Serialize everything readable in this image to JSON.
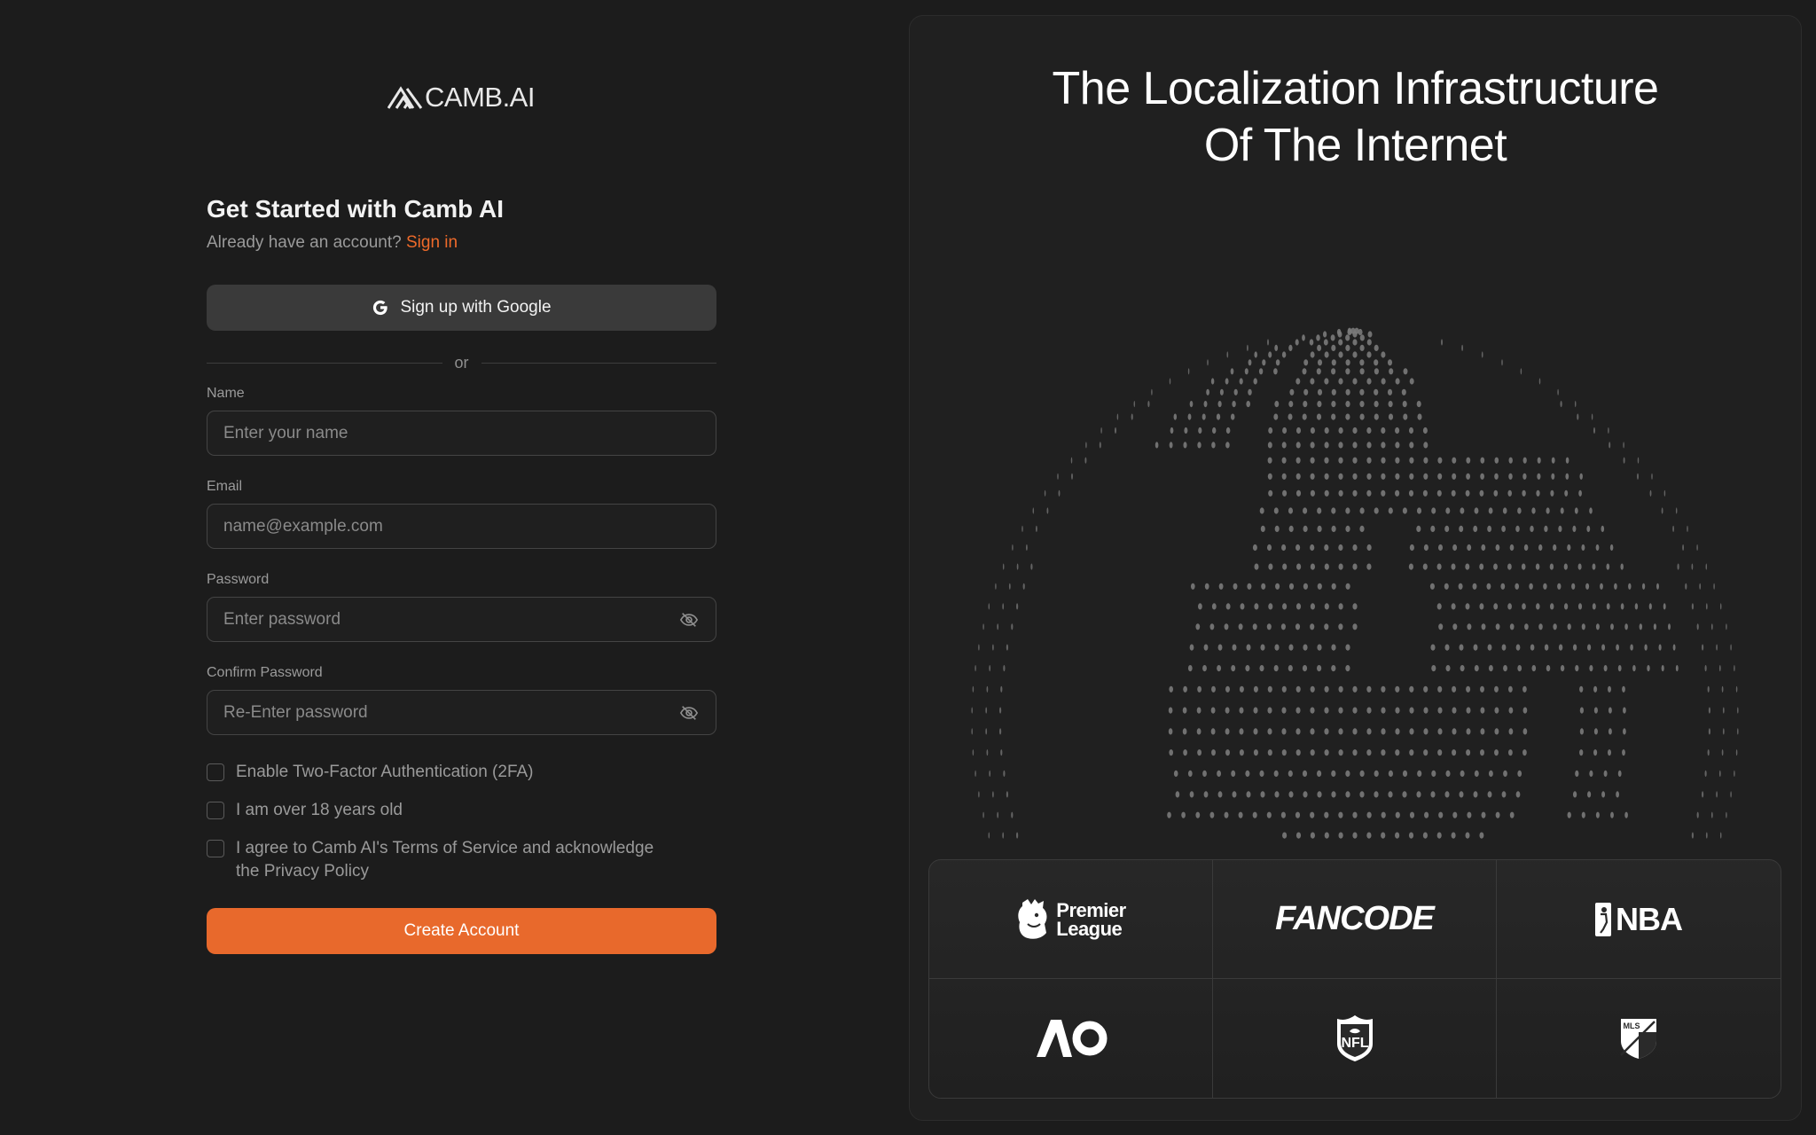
{
  "brand": {
    "logo_text": "CAMB.AI"
  },
  "signup": {
    "title": "Get Started with Camb AI",
    "have_account": "Already have an account?",
    "signin_link": "Sign in",
    "google_button": "Sign up with Google",
    "divider": "or",
    "fields": {
      "name": {
        "label": "Name",
        "placeholder": "Enter your name"
      },
      "email": {
        "label": "Email",
        "placeholder": "name@example.com"
      },
      "password": {
        "label": "Password",
        "placeholder": "Enter password"
      },
      "confirm": {
        "label": "Confirm Password",
        "placeholder": "Re-Enter password"
      }
    },
    "checks": {
      "twofa": "Enable Two-Factor Authentication (2FA)",
      "age": "I am over 18 years old",
      "terms": "I agree to Camb AI's Terms of Service and acknowledge the Privacy Policy"
    },
    "create_button": "Create Account"
  },
  "hero": {
    "headline_line1": "The Localization Infrastructure",
    "headline_line2": "Of The Internet"
  },
  "partners": {
    "premier_league_line1": "Premier",
    "premier_league_line2": "League",
    "fancode": "FANCODE",
    "nba": "NBA",
    "ao": "AO",
    "nfl": "NFL",
    "mls": "MLS"
  },
  "colors": {
    "accent": "#e8692c",
    "background": "#1c1c1c",
    "panel": "#202020"
  }
}
